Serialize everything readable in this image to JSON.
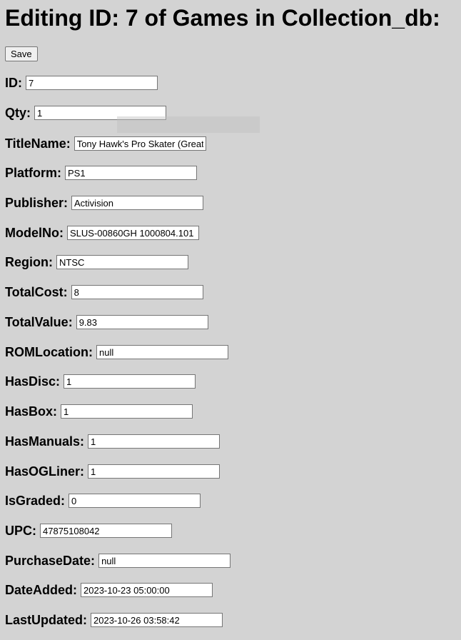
{
  "page": {
    "heading": "Editing ID: 7 of Games in Collection_db:",
    "save_label": "Save"
  },
  "fields": [
    {
      "label": "ID:",
      "value": "7"
    },
    {
      "label": "Qty:",
      "value": "1"
    },
    {
      "label": "TitleName:",
      "value": "Tony Hawk's Pro Skater (Greatest Hits)"
    },
    {
      "label": "Platform:",
      "value": "PS1"
    },
    {
      "label": "Publisher:",
      "value": "Activision"
    },
    {
      "label": "ModelNo:",
      "value": "SLUS-00860GH 1000804.101"
    },
    {
      "label": "Region:",
      "value": "NTSC"
    },
    {
      "label": "TotalCost:",
      "value": "8"
    },
    {
      "label": "TotalValue:",
      "value": "9.83"
    },
    {
      "label": "ROMLocation:",
      "value": "null"
    },
    {
      "label": "HasDisc:",
      "value": "1"
    },
    {
      "label": "HasBox:",
      "value": "1"
    },
    {
      "label": "HasManuals:",
      "value": "1"
    },
    {
      "label": "HasOGLiner:",
      "value": "1"
    },
    {
      "label": "IsGraded:",
      "value": "0"
    },
    {
      "label": "UPC:",
      "value": "47875108042"
    },
    {
      "label": "PurchaseDate:",
      "value": "null"
    },
    {
      "label": "DateAdded:",
      "value": "2023-10-23 05:00:00"
    },
    {
      "label": "LastUpdated:",
      "value": "2023-10-26 03:58:42"
    }
  ]
}
